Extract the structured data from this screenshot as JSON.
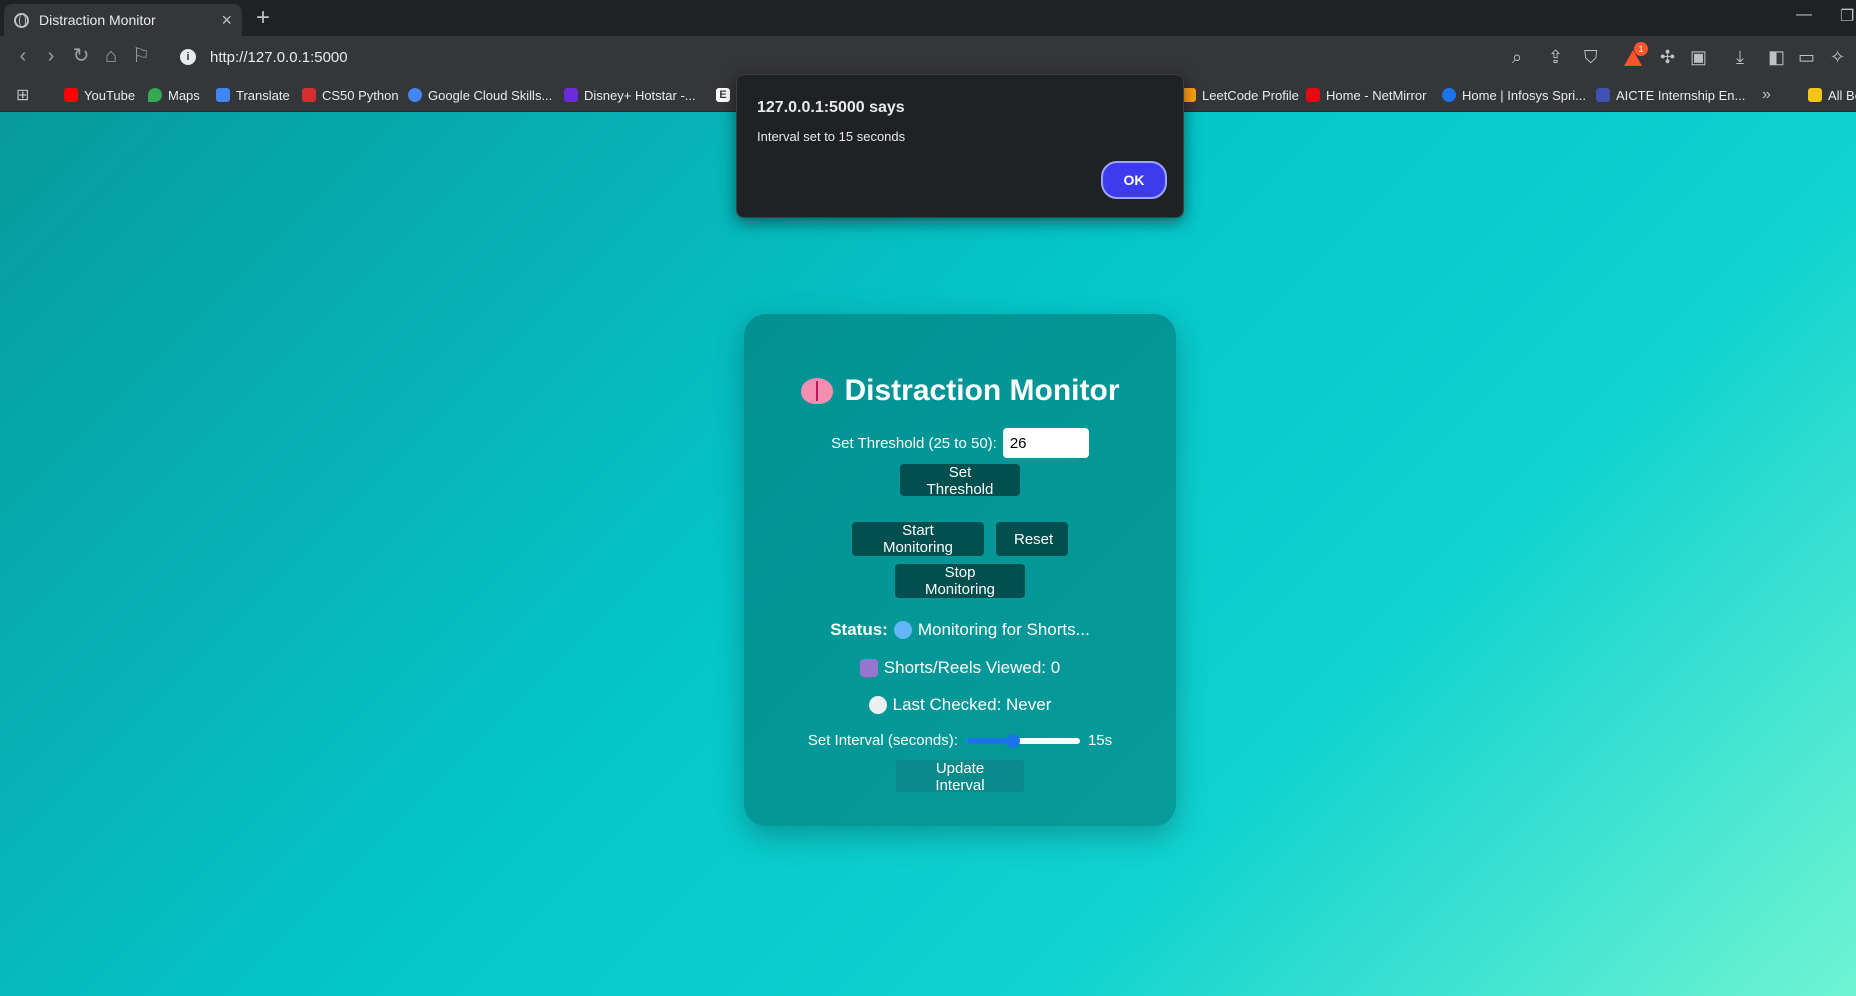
{
  "browser": {
    "tab_title": "Distraction Monitor",
    "tab_close": "×",
    "new_tab": "+",
    "url": "http://127.0.0.1:5000",
    "brave_count": "1"
  },
  "bookmarks": [
    {
      "label": "YouTube",
      "color": "#ff0000"
    },
    {
      "label": "Maps",
      "color": "#34a853"
    },
    {
      "label": "Translate",
      "color": "#4285f4"
    },
    {
      "label": "CS50 Python",
      "color": "#d32f2f"
    },
    {
      "label": "Google Cloud Skills...",
      "color": "#4285f4"
    },
    {
      "label": "Disney+ Hotstar -...",
      "color": "#6c2bd9"
    },
    {
      "label": "E",
      "color": "#ffffff"
    },
    {
      "label": "LeetCode Profile",
      "color": "#ffa116"
    },
    {
      "label": "Home - NetMirror",
      "color": "#e50914"
    },
    {
      "label": "Home | Infosys Spri...",
      "color": "#1a73e8"
    },
    {
      "label": "AICTE Internship En...",
      "color": "#3f51b5"
    },
    {
      "label": "All Bo",
      "color": "#f5c518"
    }
  ],
  "dialog": {
    "title": "127.0.0.1:5000 says",
    "message": "Interval set to 15 seconds",
    "ok_label": "OK"
  },
  "app": {
    "title": "Distraction Monitor",
    "threshold_label": "Set Threshold (25 to 50):",
    "threshold_value": "26",
    "set_threshold_label": "Set Threshold",
    "start_label": "Start Monitoring",
    "reset_label": "Reset",
    "stop_label": "Stop Monitoring",
    "status_label": "Status:",
    "status_value": "Monitoring for Shorts...",
    "viewed_text": "Shorts/Reels Viewed: 0",
    "last_checked_text": "Last Checked: Never",
    "interval_label": "Set Interval (seconds):",
    "interval_value_text": "15s",
    "interval_fraction": 0.4,
    "update_interval_label": "Update Interval"
  }
}
